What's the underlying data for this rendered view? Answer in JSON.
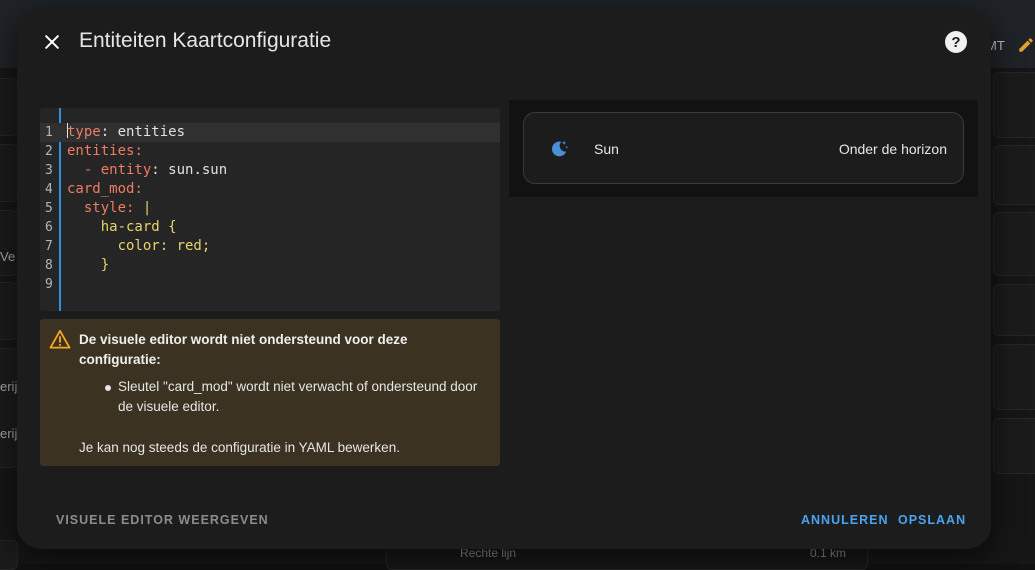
{
  "background": {
    "partial_tag": "MT",
    "partial_left_texts": [
      "Ve",
      "erij",
      "erij"
    ],
    "bottom_row": {
      "label": "Rechte lijn",
      "value": "0.1 km"
    }
  },
  "dialog": {
    "title": "Entiteiten Kaartconfiguratie",
    "close_icon": "close-icon",
    "help_icon": "help-icon",
    "help_glyph": "?"
  },
  "editor": {
    "lines": [
      {
        "number": "1",
        "key": "type",
        "sep": ": ",
        "value": "entities"
      },
      {
        "number": "2",
        "key": "entities",
        "sep": ":",
        "value": ""
      },
      {
        "number": "3",
        "prefix": "  - ",
        "key": "entity",
        "sep": ": ",
        "value": "sun.sun"
      },
      {
        "number": "4",
        "key": "card_mod",
        "sep": ":",
        "value": ""
      },
      {
        "number": "5",
        "prefix": "  ",
        "key": "style",
        "sep": ": ",
        "value": "|"
      },
      {
        "number": "6",
        "prefix": "    ",
        "text": "ha-card {"
      },
      {
        "number": "7",
        "prefix": "      ",
        "text": "color: red;"
      },
      {
        "number": "8",
        "prefix": "    ",
        "text": "}"
      },
      {
        "number": "9",
        "text": ""
      }
    ]
  },
  "warning": {
    "icon": "warning-icon",
    "title": "De visuele editor wordt niet ondersteund voor deze configuratie:",
    "items": [
      "Sleutel \"card_mod\" wordt niet verwacht of ondersteund door de visuele editor."
    ],
    "footer": "Je kan nog steeds de configuratie in YAML bewerken."
  },
  "preview": {
    "entity_icon": "weather-night-icon",
    "entity_name": "Sun",
    "entity_state": "Onder de horizon"
  },
  "buttons": {
    "visual_editor": "VISUELE EDITOR WEERGEVEN",
    "cancel": "ANNULEREN",
    "save": "OPSLAAN"
  },
  "colors": {
    "accent": "#4aa3ee",
    "warning_bg": "#3b3221",
    "warning_icon": "#f5a623",
    "yaml_key": "#f07b63",
    "yaml_string": "#e6d46a"
  }
}
